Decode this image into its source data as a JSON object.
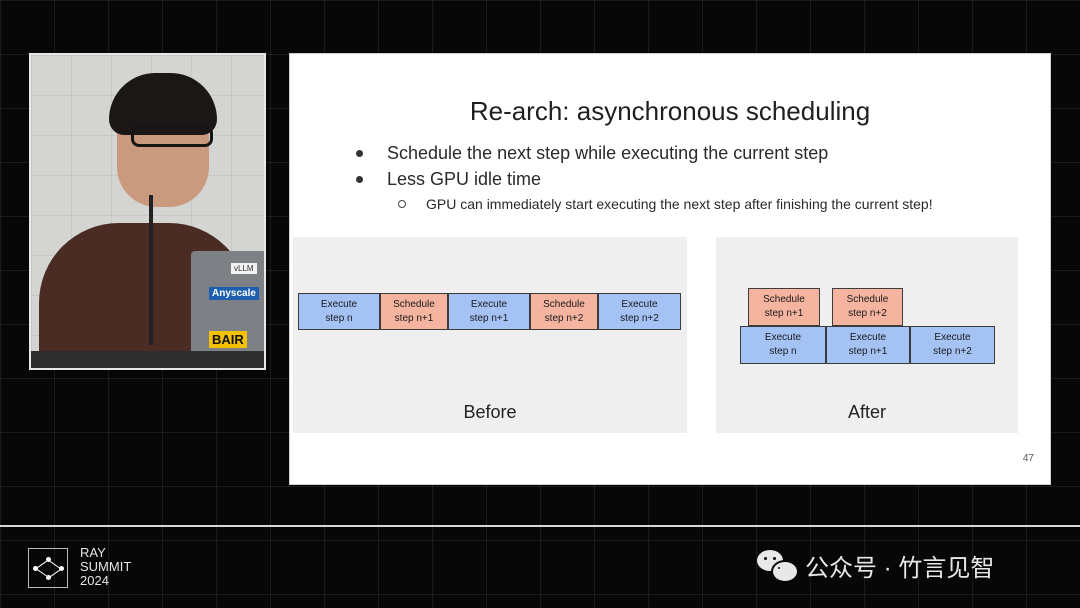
{
  "speaker": {
    "stickers": [
      "vLLM",
      "Anyscale",
      "BAIR"
    ]
  },
  "slide": {
    "title": "Re-arch: asynchronous scheduling",
    "bullets": [
      "Schedule the next step while executing the current step",
      "Less GPU idle time"
    ],
    "sub_bullet": "GPU can immediately start executing the next step after finishing the current step!",
    "before": {
      "caption": "Before",
      "blocks": [
        {
          "kind": "execute",
          "line1": "Execute",
          "line2": "step n"
        },
        {
          "kind": "schedule",
          "line1": "Schedule",
          "line2": "step n+1"
        },
        {
          "kind": "execute",
          "line1": "Execute",
          "line2": "step n+1"
        },
        {
          "kind": "schedule",
          "line1": "Schedule",
          "line2": "step n+2"
        },
        {
          "kind": "execute",
          "line1": "Execute",
          "line2": "step n+2"
        }
      ]
    },
    "after": {
      "caption": "After",
      "schedule_blocks": [
        {
          "line1": "Schedule",
          "line2": "step n+1"
        },
        {
          "line1": "Schedule",
          "line2": "step n+2"
        }
      ],
      "execute_blocks": [
        {
          "line1": "Execute",
          "line2": "step n"
        },
        {
          "line1": "Execute",
          "line2": "step n+1"
        },
        {
          "line1": "Execute",
          "line2": "step n+2"
        }
      ]
    },
    "page_number": "47"
  },
  "branding": {
    "ray_line1": "RAY",
    "ray_line2": "SUMMIT",
    "ray_line3": "2024",
    "watermark": "公众号 · 竹言见智"
  },
  "colors": {
    "execute": "#a4c2f4",
    "schedule": "#f4b4a0",
    "background": "#070707"
  },
  "icons": {
    "logo": "ray-network-icon",
    "watermark": "wechat-icon"
  }
}
